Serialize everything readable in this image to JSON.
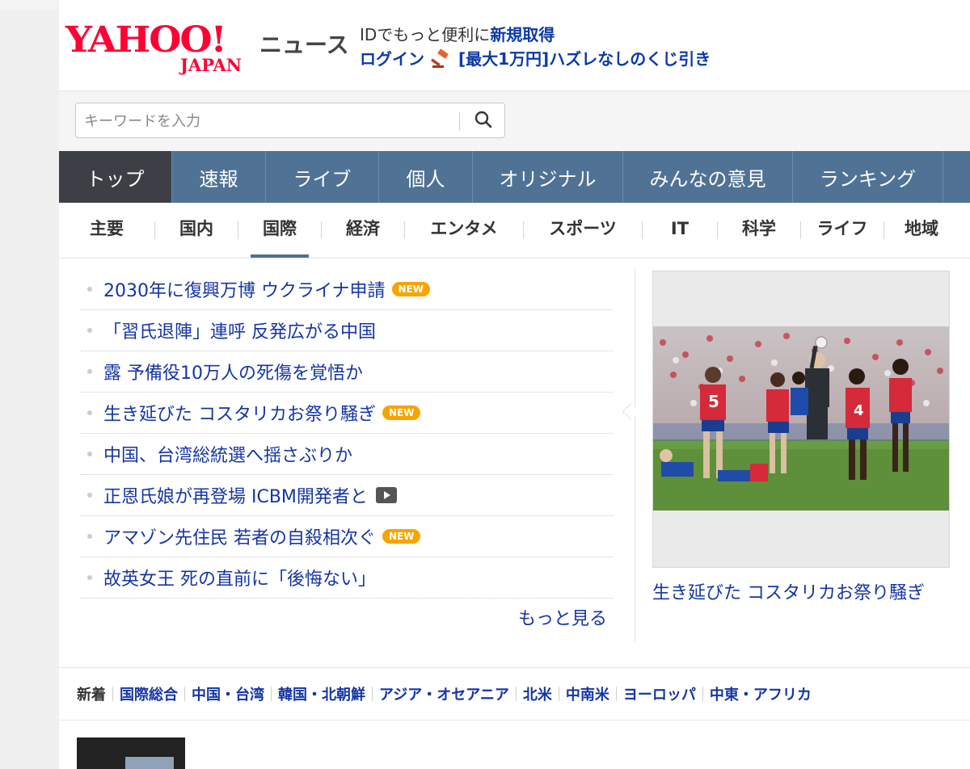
{
  "header": {
    "logo_text": "YAHOO!",
    "logo_sub": "JAPAN",
    "service_name": "ニュース",
    "promo_line1_prefix": "IDでもっと便利に",
    "promo_line1_link": "新規取得",
    "login_label": "ログイン",
    "gavel_icon": "gavel-icon",
    "lottery_label": "[最大1万円]ハズレなしのくじ引き"
  },
  "search": {
    "placeholder": "キーワードを入力",
    "button_icon": "search-icon"
  },
  "nav": {
    "tabs": [
      {
        "label": "トップ",
        "active": true
      },
      {
        "label": "速報"
      },
      {
        "label": "ライブ"
      },
      {
        "label": "個人"
      },
      {
        "label": "オリジナル"
      },
      {
        "label": "みんなの意見"
      },
      {
        "label": "ランキング"
      }
    ]
  },
  "subnav": {
    "items": [
      {
        "label": "主要"
      },
      {
        "label": "国内"
      },
      {
        "label": "国際",
        "active": true
      },
      {
        "label": "経済"
      },
      {
        "label": "エンタメ"
      },
      {
        "label": "スポーツ"
      },
      {
        "label": "IT"
      },
      {
        "label": "科学"
      },
      {
        "label": "ライフ"
      },
      {
        "label": "地域"
      }
    ]
  },
  "headlines": [
    {
      "text": "2030年に復興万博 ウクライナ申請",
      "badge": "NEW"
    },
    {
      "text": "「習氏退陣」連呼 反発広がる中国"
    },
    {
      "text": "露 予備役10万人の死傷を覚悟か"
    },
    {
      "text": "生き延びた コスタリカお祭り騒ぎ",
      "badge": "NEW"
    },
    {
      "text": "中国、台湾総統選へ揺さぶりか"
    },
    {
      "text": "正恩氏娘が再登場 ICBM開発者と",
      "video": true
    },
    {
      "text": "アマゾン先住民 若者の自殺相次ぐ",
      "badge": "NEW"
    },
    {
      "text": "故英女王 死の直前に「後悔ない」"
    }
  ],
  "more_label": "もっと見る",
  "feature": {
    "caption": "生き延びた コスタリカお祭り騒ぎ",
    "image_subject": "soccer-match-photo"
  },
  "categories": [
    "新着",
    "国際総合",
    "中国・台湾",
    "韓国・北朝鮮",
    "アジア・オセアニア",
    "北米",
    "中南米",
    "ヨーロッパ",
    "中東・アフリカ"
  ],
  "colors": {
    "brand_red": "#ff0033",
    "nav_blue": "#4f7295",
    "nav_active": "#3c4046",
    "link_blue": "#1535a3",
    "new_badge": "#f6a500"
  }
}
